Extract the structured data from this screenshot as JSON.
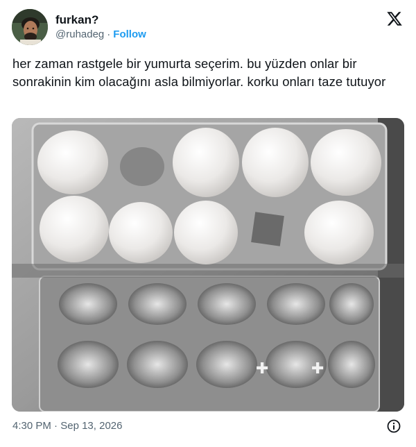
{
  "author": {
    "display_name": "furkan?",
    "handle": "@ruhadeg",
    "separator": "·",
    "follow_label": "Follow"
  },
  "icons": {
    "platform_logo": "x-logo-icon",
    "info": "info-icon"
  },
  "tweet": {
    "text": "her zaman rastgele bir yumurta seçerim. bu yüzden onlar bir sonrakinin kim olacağını asla bilmiyorlar. korku onları taze tutuyor",
    "time": "4:30 PM",
    "separator": "·",
    "date": "Sep 13, 2026"
  },
  "colors": {
    "text": "#0f1419",
    "secondary": "#536471",
    "link": "#1d9bf0"
  }
}
